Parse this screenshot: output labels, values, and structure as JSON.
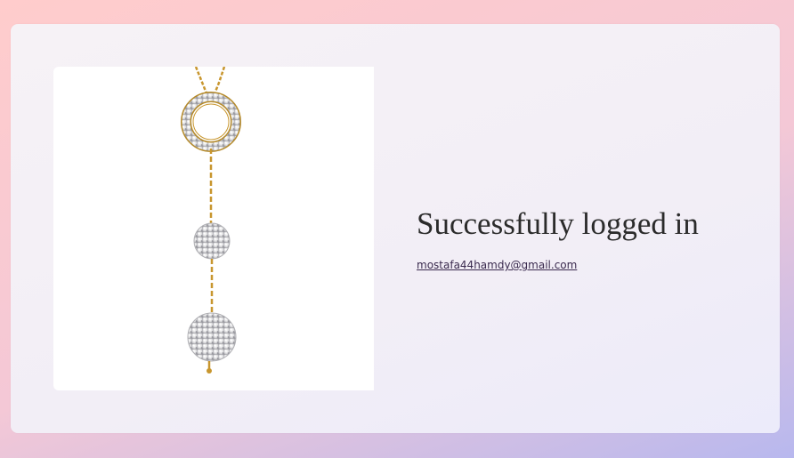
{
  "product_image": {
    "alt": "gold chain pendant with crystal ring and crystal balls",
    "icon": "necklace-image"
  },
  "status": {
    "title": "Successfully logged in",
    "email": "mostafa44hamdy@gmail.com"
  },
  "colors": {
    "background_start": "#ffcccc",
    "background_end": "#b8b8ee",
    "card": "#f3eff6",
    "gold": "#c8962e",
    "crystal": "#e8e8ea"
  }
}
